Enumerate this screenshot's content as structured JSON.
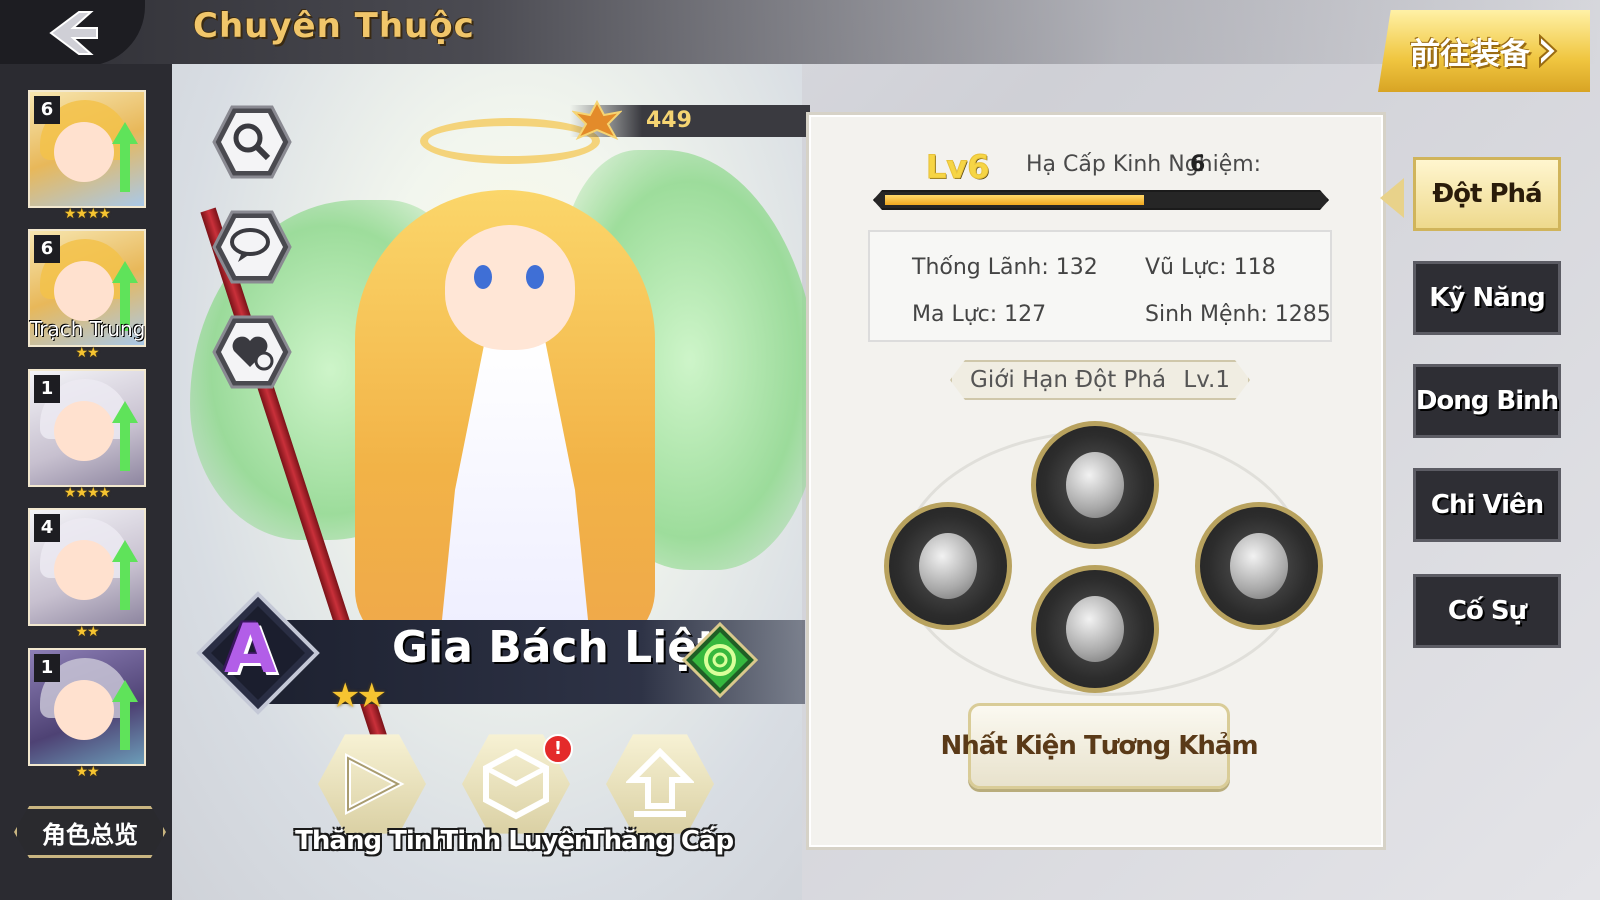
{
  "header": {
    "title": "Chuyên Thuộc",
    "goto_button": "前往装备"
  },
  "hero_list": {
    "items": [
      {
        "level": "6",
        "stars": "★★★★"
      },
      {
        "level": "6",
        "stars": "★★",
        "name": "Trạch Trung"
      },
      {
        "level": "1",
        "stars": "★★★★"
      },
      {
        "level": "4",
        "stars": "★★"
      },
      {
        "level": "1",
        "stars": "★★"
      }
    ],
    "overview_button": "角色总览"
  },
  "hero": {
    "name": "Gia Bách Liệt",
    "rank": "A",
    "power": "449",
    "stars": "★★"
  },
  "actions": {
    "ascend": "Thăng Tinh",
    "refine": "Tinh Luyện",
    "level_up": "Thăng Cấp",
    "alert": "!"
  },
  "panel": {
    "level": "Lv6",
    "exp_label": "Hạ Cấp Kinh Nghiệm:",
    "exp_num": "6",
    "exp_progress": 0.6,
    "stats": {
      "command_label": "Thống Lãnh:",
      "command_value": "132",
      "force_label": "Vũ Lực:",
      "force_value": "118",
      "magic_label": "Ma Lực:",
      "magic_value": "127",
      "life_label": "Sinh Mệnh:",
      "life_value": "1285"
    },
    "limit_label": "Giới Hạn Đột Phá",
    "limit_level": "Lv.1",
    "equip_all": "Nhất Kiện Tương Khảm"
  },
  "tabs": [
    {
      "label": "Đột Phá",
      "active": true
    },
    {
      "label": "Kỹ Năng"
    },
    {
      "label": "Dong Binh"
    },
    {
      "label": "Chi Viên"
    },
    {
      "label": "Cố Sự"
    }
  ],
  "colors": {
    "accent_gold": "#f0c640",
    "title_gold": "#f1c66a",
    "exp_fill": "#f0a81f",
    "dark_panel": "#2e2e34"
  },
  "icons": [
    "back-arrow-icon",
    "search-icon",
    "chat-search-icon",
    "heart-plus-icon",
    "power-icon",
    "element-swirl-icon",
    "ascend-icon",
    "refine-icon",
    "level-up-icon",
    "gem-icon"
  ]
}
